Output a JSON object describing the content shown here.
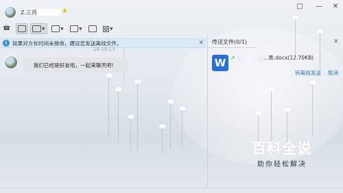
{
  "window": {
    "contact_name": "Z.三月",
    "controls": [
      "□",
      "—",
      "✕"
    ]
  },
  "toolbar": {
    "items": [
      {
        "icon": "phone-icon",
        "label": "☎"
      },
      {
        "icon": "video-call-icon",
        "label": ""
      },
      {
        "icon": "screen-share-icon",
        "label": ""
      },
      {
        "icon": "send-file-icon",
        "label": ""
      },
      {
        "icon": "remote-desktop-icon",
        "label": ""
      },
      {
        "icon": "create-group-icon",
        "label": ""
      },
      {
        "icon": "apps-icon",
        "label": ""
      }
    ]
  },
  "notice": {
    "text": "如果对方长时间未接收，建议您发送离线文件。",
    "close": "✕"
  },
  "chat": {
    "timestamp": "18:15:13",
    "messages": [
      {
        "text": "我们已经是好友啦，一起来聊天吧！"
      }
    ]
  },
  "file_panel": {
    "tab_label": "传送文件(0/1)",
    "close": "✕",
    "file_icon_letter": "W",
    "file_name_suffix": "表.docx(12.70KB)",
    "file_name_middle": "...",
    "send_offline": "转离线发送",
    "cancel": "取消"
  },
  "watermark": {
    "title": "百科全说",
    "subtitle": "助你轻松解决"
  },
  "colors": {
    "accent": "#2f74c8",
    "notice_bg": "#d9e9f7",
    "file_icon": "#2b6fd8"
  }
}
